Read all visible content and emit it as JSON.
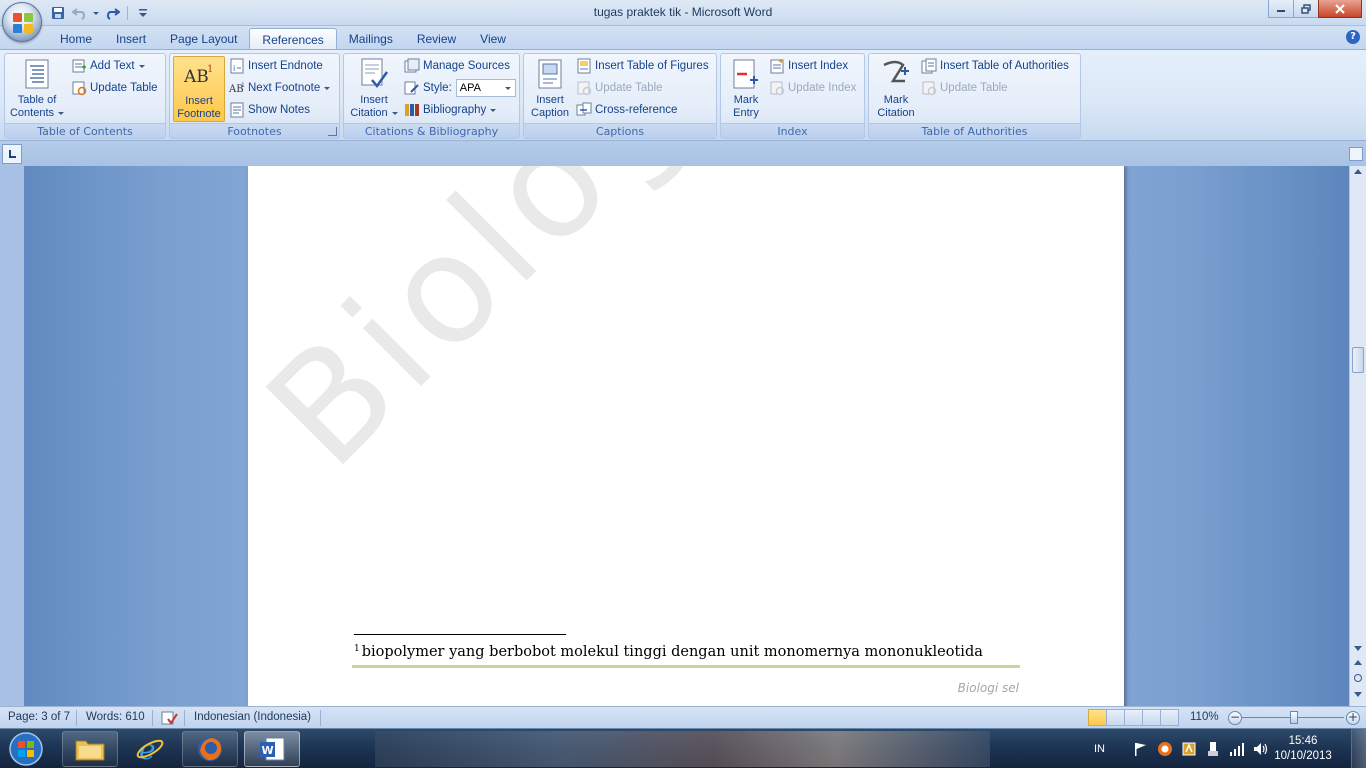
{
  "window": {
    "title": "tugas praktek tik - Microsoft Word"
  },
  "tabs": [
    {
      "label": "Home"
    },
    {
      "label": "Insert"
    },
    {
      "label": "Page Layout"
    },
    {
      "label": "References",
      "active": true
    },
    {
      "label": "Mailings"
    },
    {
      "label": "Review"
    },
    {
      "label": "View"
    }
  ],
  "ribbon": {
    "toc": {
      "group_label": "Table of Contents",
      "toc_line1": "Table of",
      "toc_line2": "Contents",
      "add_text": "Add Text",
      "update_table": "Update Table"
    },
    "footnotes": {
      "group_label": "Footnotes",
      "insert_footnote_line1": "Insert",
      "insert_footnote_line2": "Footnote",
      "insert_endnote": "Insert Endnote",
      "next_footnote": "Next Footnote",
      "show_notes": "Show Notes"
    },
    "citations": {
      "group_label": "Citations & Bibliography",
      "insert_citation_line1": "Insert",
      "insert_citation_line2": "Citation",
      "manage_sources": "Manage Sources",
      "style_label": "Style:",
      "style_value": "APA",
      "bibliography": "Bibliography"
    },
    "captions": {
      "group_label": "Captions",
      "insert_caption_line1": "Insert",
      "insert_caption_line2": "Caption",
      "insert_table_of_figures": "Insert Table of Figures",
      "update_table": "Update Table",
      "cross_reference": "Cross-reference"
    },
    "index": {
      "group_label": "Index",
      "mark_entry_line1": "Mark",
      "mark_entry_line2": "Entry",
      "insert_index": "Insert Index",
      "update_index": "Update Index"
    },
    "authorities": {
      "group_label": "Table of Authorities",
      "mark_citation_line1": "Mark",
      "mark_citation_line2": "Citation",
      "insert_table_of_authorities": "Insert Table of Authorities",
      "update_table": "Update Table"
    }
  },
  "document": {
    "watermark": "Biologi sel",
    "footnote_number": "1",
    "footnote_text": "biopolymer yang berbobot molekul tinggi dengan unit monomernya mononukleotida",
    "footer_text": "Biologi sel"
  },
  "status": {
    "page": "Page: 3 of 7",
    "words": "Words: 610",
    "language": "Indonesian (Indonesia)",
    "zoom": "110%"
  },
  "taskbar": {
    "language": "IN",
    "time": "15:46",
    "date": "10/10/2013"
  },
  "colors": {
    "ribbon_text": "#15428b",
    "active_button": "#ffc74a",
    "footer_rule": "#c3d69b"
  }
}
